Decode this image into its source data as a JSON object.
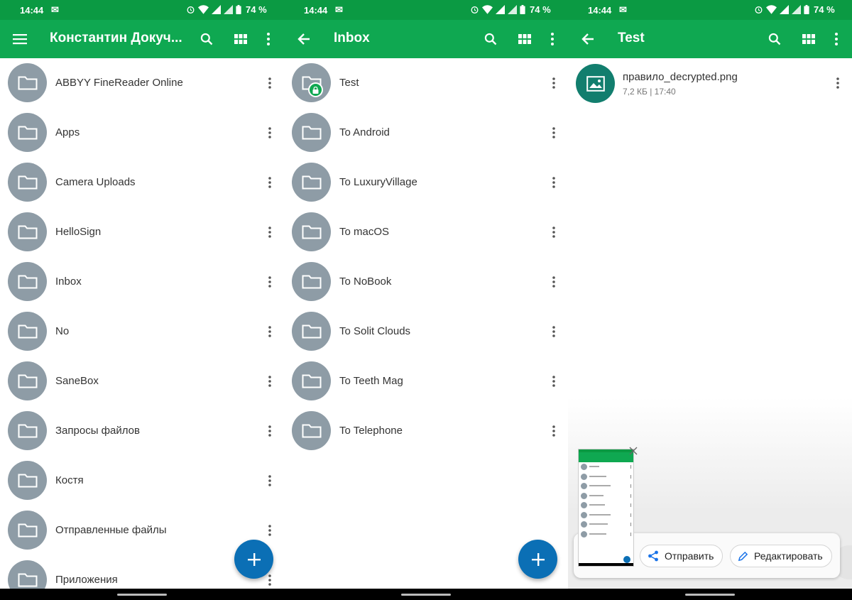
{
  "status": {
    "time": "14:44",
    "battery": "74 %"
  },
  "screen1": {
    "title": "Константин Докуч...",
    "items": [
      {
        "label": "ABBYY FineReader Online"
      },
      {
        "label": "Apps"
      },
      {
        "label": "Camera Uploads"
      },
      {
        "label": "HelloSign"
      },
      {
        "label": "Inbox"
      },
      {
        "label": "No"
      },
      {
        "label": "SaneBox"
      },
      {
        "label": "Запросы файлов"
      },
      {
        "label": "Костя"
      },
      {
        "label": "Отправленные файлы"
      },
      {
        "label": "Приложения"
      }
    ]
  },
  "screen2": {
    "title": "Inbox",
    "items": [
      {
        "label": "Test",
        "locked": true
      },
      {
        "label": "To Android"
      },
      {
        "label": "To LuxuryVillage"
      },
      {
        "label": "To macOS"
      },
      {
        "label": "To NoBook"
      },
      {
        "label": "To Solit Clouds"
      },
      {
        "label": "To Teeth Mag"
      },
      {
        "label": "To Telephone"
      }
    ]
  },
  "screen3": {
    "title": "Test",
    "file": {
      "name": "правило_decrypted.png",
      "meta": "7,2 КБ | 17:40"
    },
    "share_label": "Отправить",
    "edit_label": "Редактировать"
  },
  "icons": {
    "menu": "menu-icon",
    "back": "back-arrow-icon",
    "search": "search-icon",
    "grid": "grid-view-icon",
    "more": "more-vert-icon",
    "folder": "folder-icon",
    "lock": "lock-icon",
    "add": "add-icon",
    "image": "image-icon",
    "share": "share-icon",
    "edit": "pencil-icon",
    "close": "close-icon"
  },
  "colors": {
    "status_bar": "#0b9a43",
    "app_bar": "#0fa851",
    "folder": "#8e9ca6",
    "fab": "#0b6fb5",
    "file_thumb": "#127e6e"
  }
}
